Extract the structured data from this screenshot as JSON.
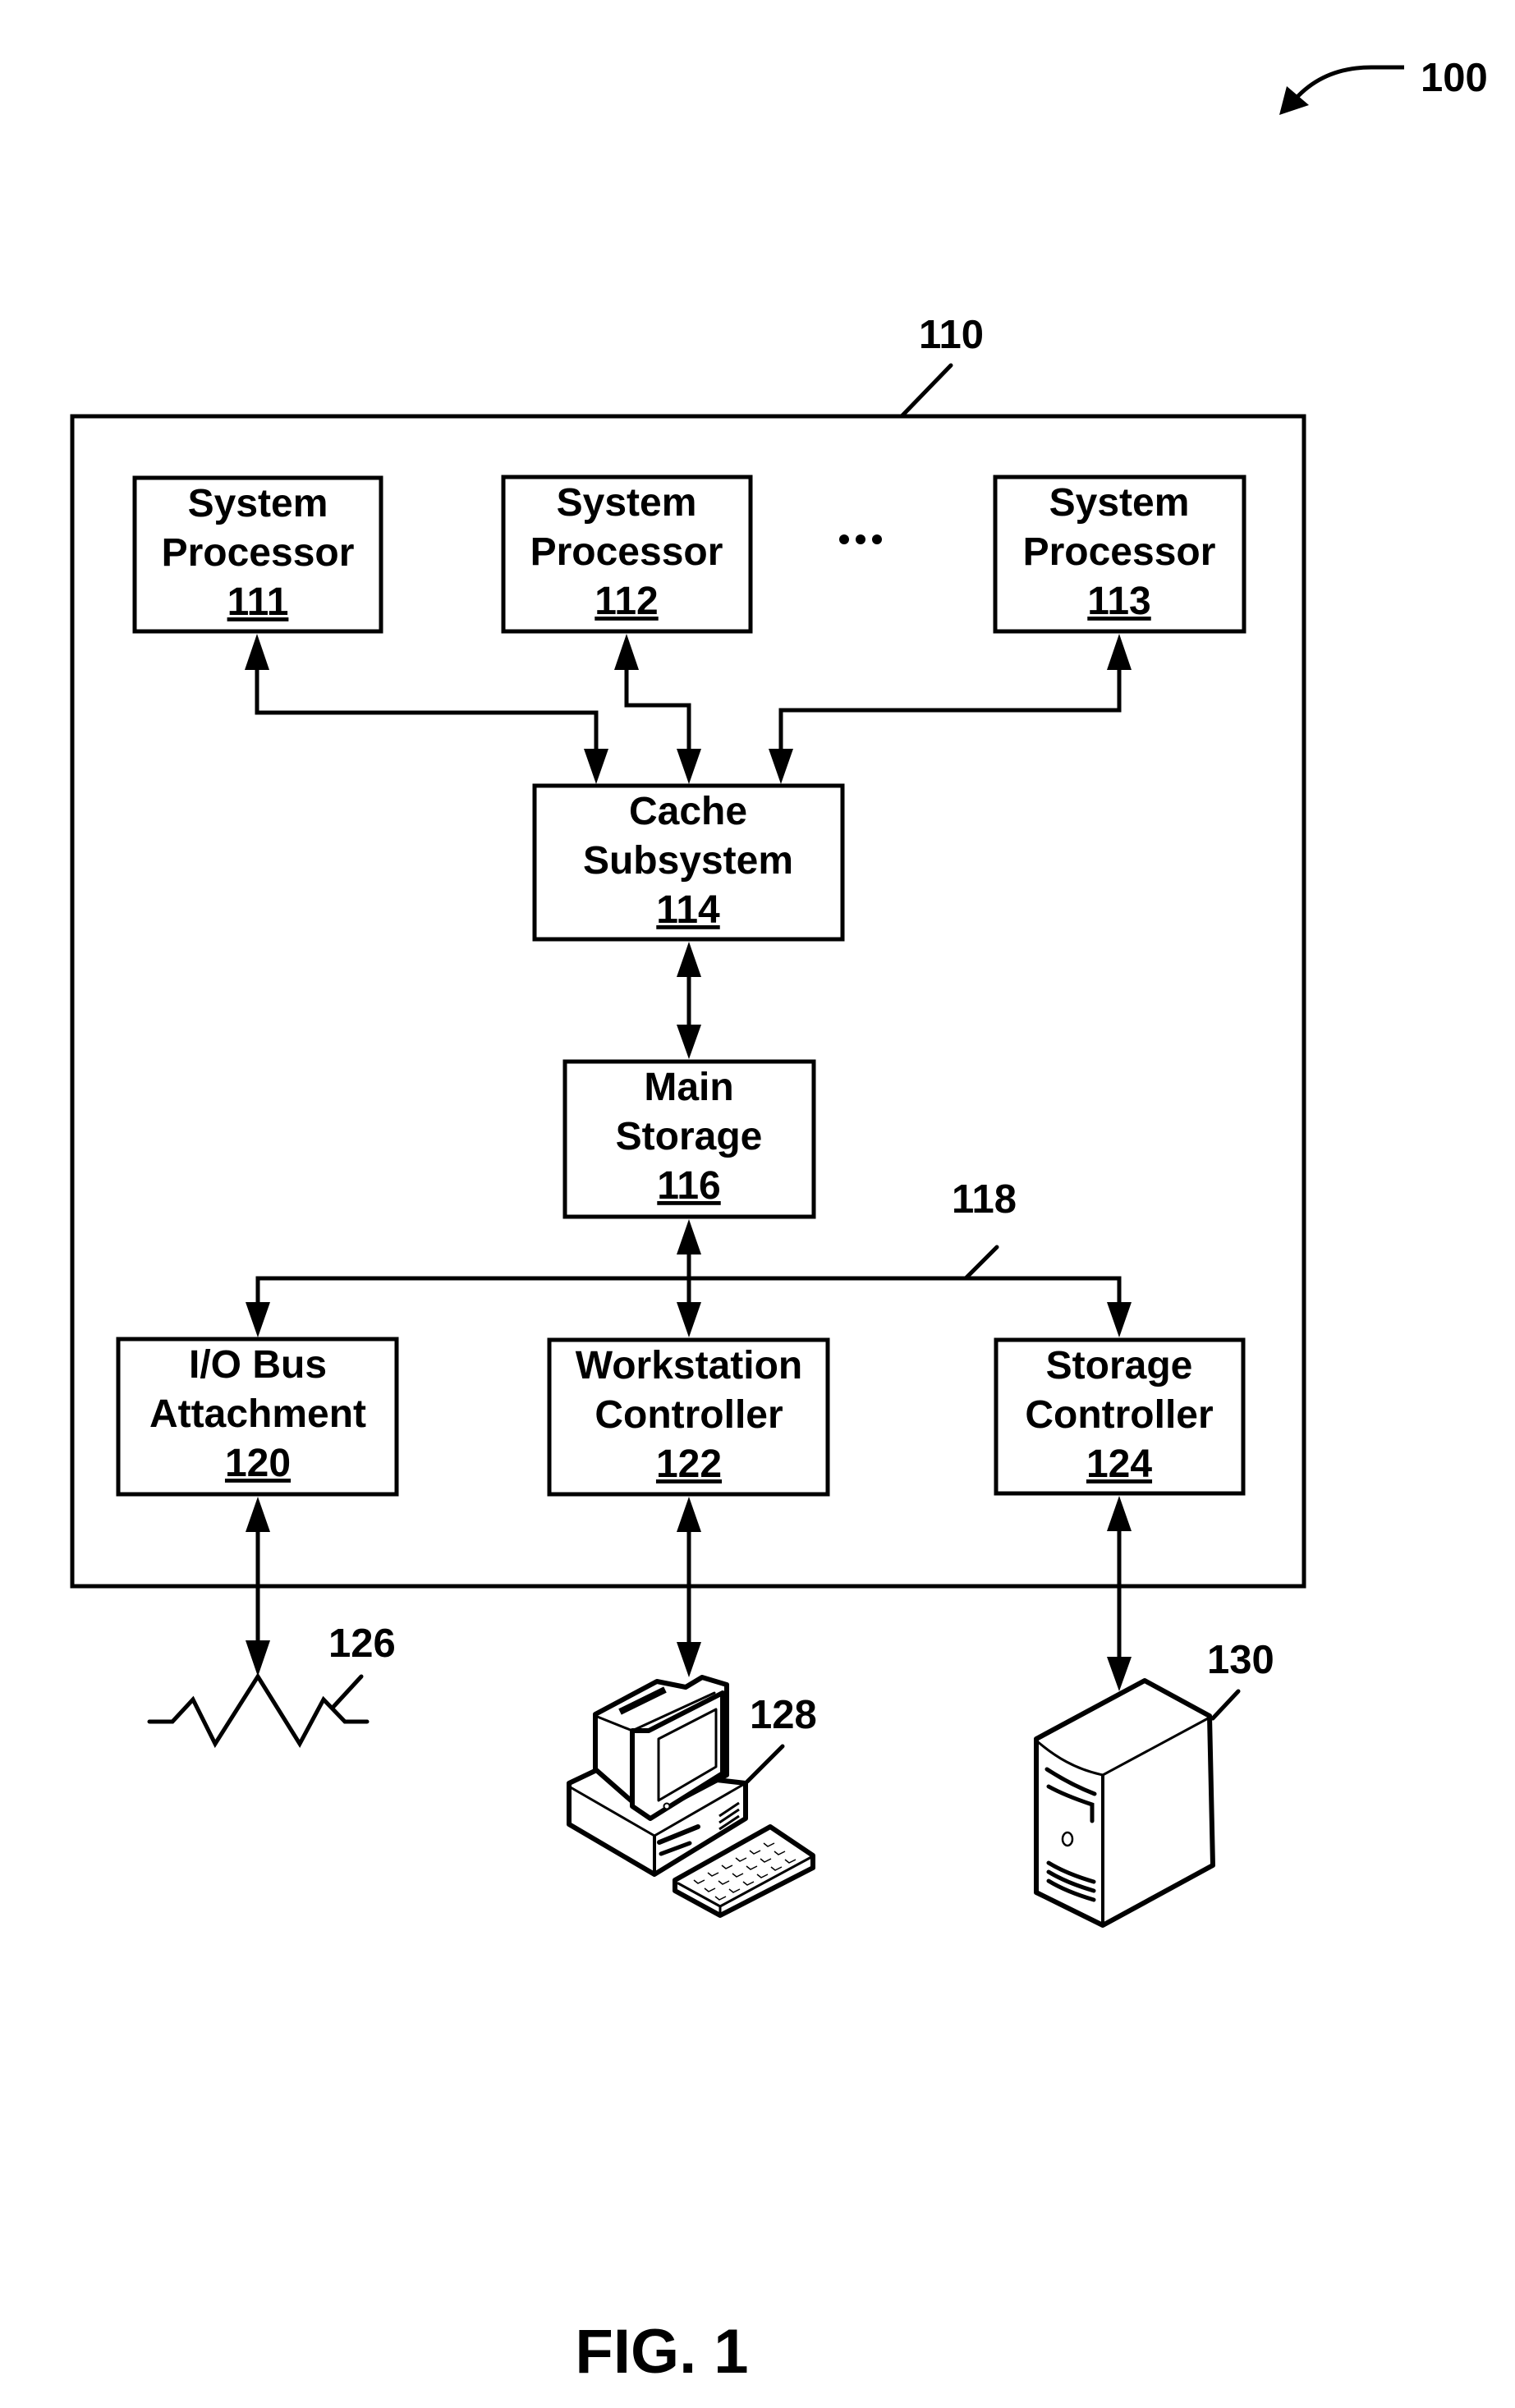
{
  "figure": {
    "caption": "FIG. 1",
    "system_ref": "100",
    "computer_ref": "110"
  },
  "processors": [
    {
      "line1": "System",
      "line2": "Processor",
      "ref": "111"
    },
    {
      "line1": "System",
      "line2": "Processor",
      "ref": "112"
    },
    {
      "line1": "System",
      "line2": "Processor",
      "ref": "113"
    }
  ],
  "ellipsis": "•••",
  "cache": {
    "line1": "Cache",
    "line2": "Subsystem",
    "ref": "114"
  },
  "main_storage": {
    "line1": "Main",
    "line2": "Storage",
    "ref": "116"
  },
  "bus": {
    "ref": "118"
  },
  "controllers": [
    {
      "line1": "I/O Bus",
      "line2": "Attachment",
      "ref": "120"
    },
    {
      "line1": "Workstation",
      "line2": "Controller",
      "ref": "122"
    },
    {
      "line1": "Storage",
      "line2": "Controller",
      "ref": "124"
    }
  ],
  "peripherals": {
    "network": {
      "ref": "126",
      "icon": "network-icon"
    },
    "workstation": {
      "ref": "128",
      "icon": "workstation-computer-icon"
    },
    "storage": {
      "ref": "130",
      "icon": "storage-tower-icon"
    }
  },
  "colors": {
    "ink": "#000000",
    "paper": "#ffffff"
  }
}
